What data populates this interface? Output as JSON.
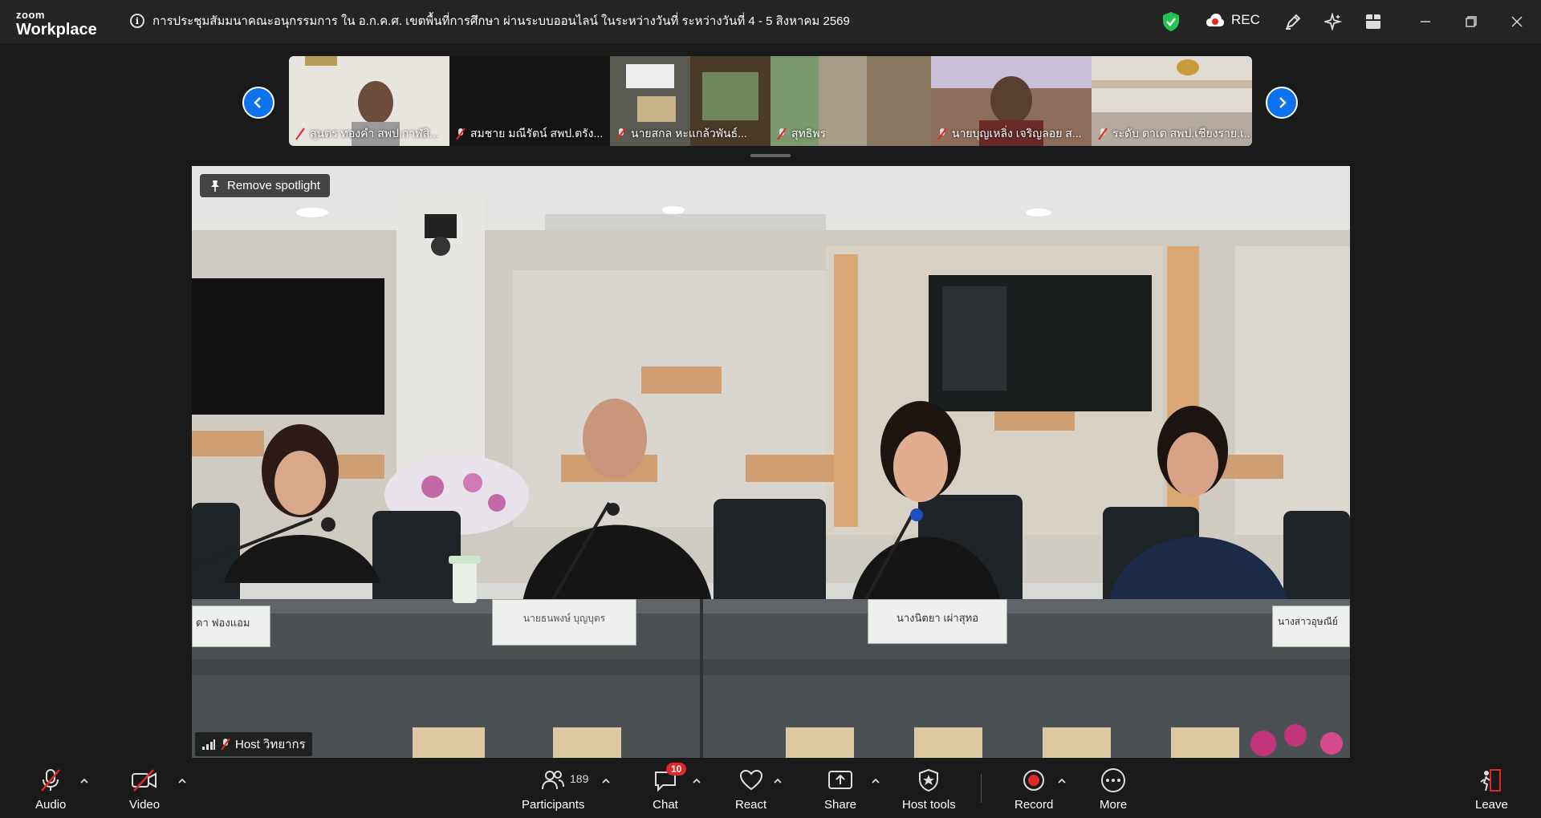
{
  "app": {
    "logo_line1": "zoom",
    "logo_line2": "Workplace"
  },
  "meeting": {
    "title": "การประชุมสัมมนาคณะอนุกรรมการ ใน อ.ก.ค.ศ. เขตพื้นที่การศึกษา ผ่านระบบออนไลน์ ในระหว่างวันที่ ระหว่างวันที่ 4 - 5 สิงหาคม 2569",
    "rec_label": "REC"
  },
  "thumbnails": [
    {
      "name": "สุนตร ทองคำ สพป.กาฬสิ...",
      "bg": "#cfc8bb"
    },
    {
      "name": "สมชาย มณีรัตน์ สพป.ตรัง...",
      "bg": "#141414"
    },
    {
      "name": "นายสกล หะแกล้วพันธ์...",
      "bg": "#6b6a62"
    },
    {
      "name": "สุทธิพร",
      "bg": "#a69a84"
    },
    {
      "name": "นายบุญเหลิ่ง เจริญลอย ส...",
      "bg": "#7d5f4e"
    },
    {
      "name": "ระดับ ตาเต สพป.เชียงราย.เ...",
      "bg": "#d2cbc4"
    }
  ],
  "spotlight": {
    "remove_label": "Remove spotlight",
    "host_label": "Host วิทยากร",
    "nameplates": [
      "ดา ฟองแอม",
      "นายธนพงษ์ บุญบุตร",
      "นางนิตยา เผ่าสุทอ",
      "นางสาวอุษณีย์"
    ]
  },
  "toolbar": {
    "audio": "Audio",
    "video": "Video",
    "participants": "Participants",
    "participants_count": "189",
    "chat": "Chat",
    "chat_badge": "10",
    "react": "React",
    "share": "Share",
    "host_tools": "Host tools",
    "record": "Record",
    "more": "More",
    "leave": "Leave"
  },
  "colors": {
    "accent_blue": "#0e72ed",
    "mute_red": "#e02828",
    "shield_green": "#23c552"
  }
}
